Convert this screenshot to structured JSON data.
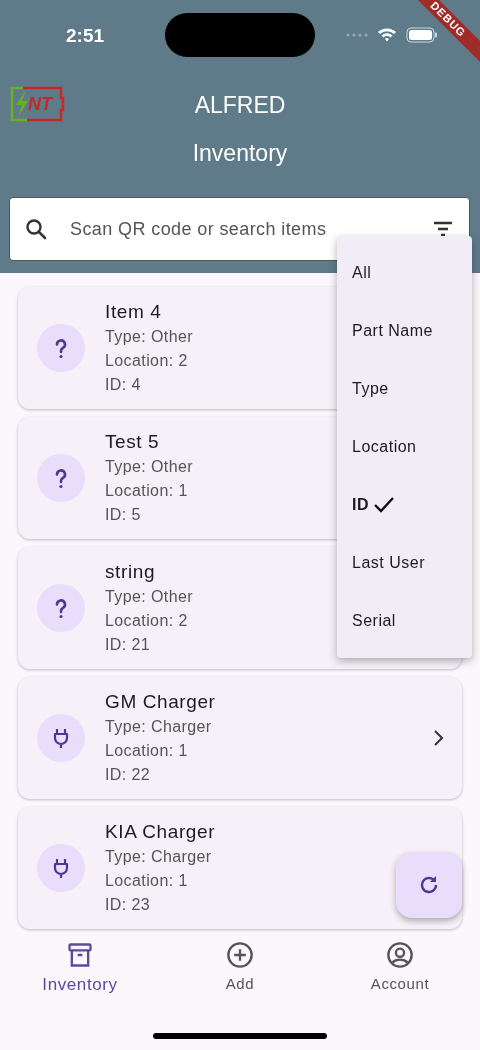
{
  "status_bar": {
    "time": "2:51"
  },
  "debug_banner": "DEBUG",
  "app_bar": {
    "logo_text": "NT",
    "title": "ALFRED",
    "subtitle": "Inventory"
  },
  "search": {
    "placeholder": "Scan QR code or search items"
  },
  "items": [
    {
      "name": "Item 4",
      "type": "Type: Other",
      "location": "Location: 2",
      "id": "ID: 4",
      "kind": "unknown"
    },
    {
      "name": "Test 5",
      "type": "Type: Other",
      "location": "Location: 1",
      "id": "ID: 5",
      "kind": "unknown"
    },
    {
      "name": "string",
      "type": "Type: Other",
      "location": "Location: 2",
      "id": "ID: 21",
      "kind": "unknown"
    },
    {
      "name": "GM Charger",
      "type": "Type: Charger",
      "location": "Location: 1",
      "id": "ID: 22",
      "kind": "charger",
      "chevron": true
    },
    {
      "name": "KIA Charger",
      "type": "Type: Charger",
      "location": "Location: 1",
      "id": "ID: 23",
      "kind": "charger"
    }
  ],
  "filter_menu": [
    {
      "label": "All",
      "selected": false
    },
    {
      "label": "Part Name",
      "selected": false
    },
    {
      "label": "Type",
      "selected": false
    },
    {
      "label": "Location",
      "selected": false
    },
    {
      "label": "ID",
      "selected": true
    },
    {
      "label": "Last User",
      "selected": false
    },
    {
      "label": "Serial",
      "selected": false
    }
  ],
  "bottom_nav": [
    {
      "label": "Inventory",
      "kind": "inventory",
      "selected": true
    },
    {
      "label": "Add",
      "kind": "add",
      "selected": false
    },
    {
      "label": "Account",
      "kind": "account",
      "selected": false
    }
  ]
}
